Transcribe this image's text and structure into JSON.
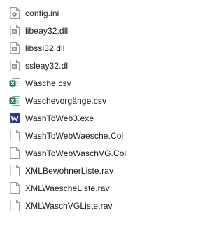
{
  "files": [
    {
      "name": "config.ini",
      "icon": "ini-settings-icon"
    },
    {
      "name": "libeay32.dll",
      "icon": "dll-file-icon"
    },
    {
      "name": "libssl32.dll",
      "icon": "dll-file-icon"
    },
    {
      "name": "ssleay32.dll",
      "icon": "dll-file-icon"
    },
    {
      "name": "Wäsche.csv",
      "icon": "excel-csv-icon"
    },
    {
      "name": "Waschevorgänge.csv",
      "icon": "excel-csv-icon"
    },
    {
      "name": "WashToWeb3.exe",
      "icon": "word-exe-icon"
    },
    {
      "name": "WashToWebWaesche.Col",
      "icon": "blank-file-icon"
    },
    {
      "name": "WashToWebWaschVG.Col",
      "icon": "blank-file-icon"
    },
    {
      "name": "XMLBewohnerListe.rav",
      "icon": "blank-file-icon"
    },
    {
      "name": "XMLWaescheListe.rav",
      "icon": "blank-file-icon"
    },
    {
      "name": "XMLWaschVGListe.rav",
      "icon": "blank-file-icon"
    }
  ],
  "colors": {
    "excel_green": "#1d6f42",
    "word_blue": "#2b579a",
    "file_border": "#9a9a9a",
    "gear_gray": "#6b7b8c",
    "dll_gray": "#8a96a3"
  }
}
